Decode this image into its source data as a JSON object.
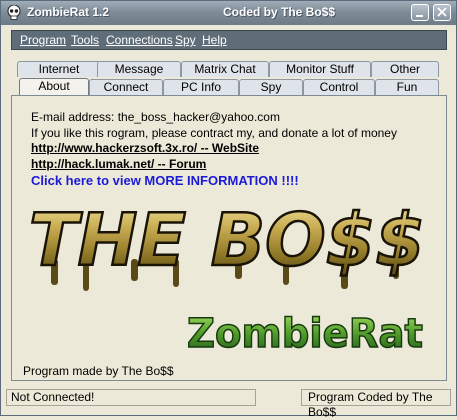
{
  "window": {
    "title": "ZombieRat 1.2",
    "subtitle": "Coded by The Bo$$"
  },
  "menu": [
    "Program",
    "Tools",
    "Connections",
    "Spy",
    "Help"
  ],
  "tabs_top": [
    "Internet",
    "Message",
    "Matrix Chat",
    "Monitor Stuff",
    "Other"
  ],
  "tabs_bottom": [
    "About",
    "Connect",
    "PC Info",
    "Spy",
    "Control",
    "Fun"
  ],
  "active_tab": "About",
  "about": {
    "email_line": "E-mail address: the_boss_hacker@yahoo.com",
    "donate_line": "If you like this rogram, please contract my, and donate a lot of money",
    "website_link": "http://www.hackerzsoft.3x.ro/  -- WebSite",
    "forum_link": "http://hack.lumak.net/  -- Forum",
    "more_info_link": "Click here to view MORE INFORMATION !!!!",
    "logo_text": "THE BO$$",
    "logo_subtext": "ZombieRat",
    "made_by": "Program made by The Bo$$"
  },
  "status": {
    "left": "Not Connected!",
    "right": "Program Coded by The Bo$$"
  },
  "icons": [
    "skull-icon",
    "minimize-icon",
    "close-icon"
  ]
}
